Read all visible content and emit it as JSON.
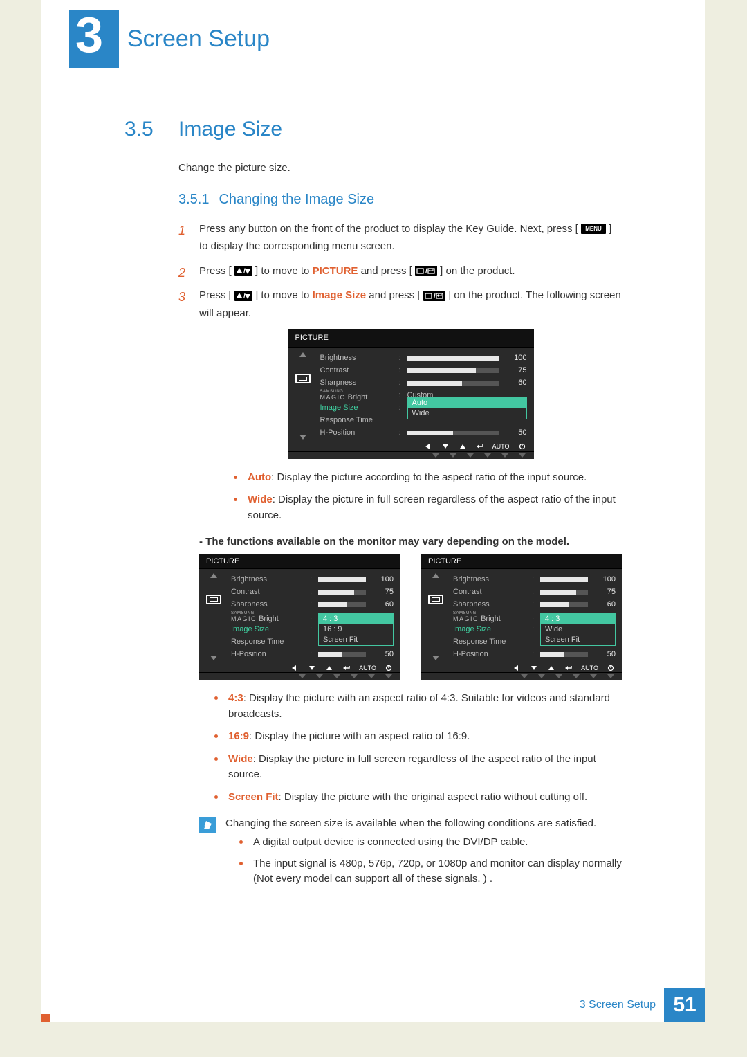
{
  "chapter": {
    "number": "3",
    "title": "Screen Setup"
  },
  "section": {
    "number": "3.5",
    "title": "Image Size",
    "intro": "Change the picture size."
  },
  "subsection": {
    "number": "3.5.1",
    "title": "Changing the Image Size"
  },
  "menu_label": "MENU",
  "steps": {
    "s1a": "Press any button on the front of the product to display the Key Guide. Next, press [",
    "s1b": "] to display the corresponding menu screen.",
    "s2a": "Press [",
    "s2b": "] to move to ",
    "s2_kw": "PICTURE",
    "s2c": " and press [",
    "s2d": "] on the product.",
    "s3a": "Press [",
    "s3b": "] to move to ",
    "s3_kw": "Image Size",
    "s3c": " and press [",
    "s3d": "] on the product. The following screen will appear."
  },
  "osd": {
    "title": "PICTURE",
    "brightness": {
      "label": "Brightness",
      "value": 100
    },
    "contrast": {
      "label": "Contrast",
      "value": 75
    },
    "sharpness": {
      "label": "Sharpness",
      "value": 60
    },
    "magic": {
      "small": "SAMSUNG",
      "big": "MAGIC",
      "suffix": " Bright",
      "value": "Custom"
    },
    "imagesize": {
      "label": "Image Size"
    },
    "response": {
      "label": "Response Time"
    },
    "hpos": {
      "label": "H-Position",
      "value": 50
    },
    "auto_label": "AUTO",
    "dd1": {
      "opt0": "Auto",
      "opt1": "Wide"
    },
    "dd2": {
      "opt0": "4 : 3",
      "opt1": "16 : 9",
      "opt2": "Screen Fit"
    },
    "dd3": {
      "opt0": "4 : 3",
      "opt1": "Wide",
      "opt2": "Screen Fit"
    }
  },
  "bullets1": {
    "auto_t": "Auto",
    "auto_d": ": Display the picture according to the aspect ratio of the input source.",
    "wide_t": "Wide",
    "wide_d": ": Display the picture in full screen regardless of the aspect ratio of the input source."
  },
  "caveat": "- The functions available on the monitor may vary depending on the model.",
  "bullets2": {
    "b43_t": "4:3",
    "b43_d": ": Display the picture with an aspect ratio of 4:3. Suitable for videos and standard broadcasts.",
    "b169_t": "16:9",
    "b169_d": ": Display the picture with an aspect ratio of 16:9.",
    "bw_t": "Wide",
    "bw_d": ": Display the picture in full screen regardless of the aspect ratio of the input source.",
    "bs_t": "Screen Fit",
    "bs_d": ": Display the picture with the original aspect ratio without cutting off."
  },
  "note": {
    "lead": "Changing the screen size is available when the following conditions are satisfied.",
    "n1": "A digital output device is connected using the DVI/DP cable.",
    "n2": "The input signal is 480p, 576p, 720p, or 1080p and monitor can display normally (Not every model can support all of these signals. ) ."
  },
  "footer": {
    "text": "3 Screen Setup",
    "page": "51"
  }
}
